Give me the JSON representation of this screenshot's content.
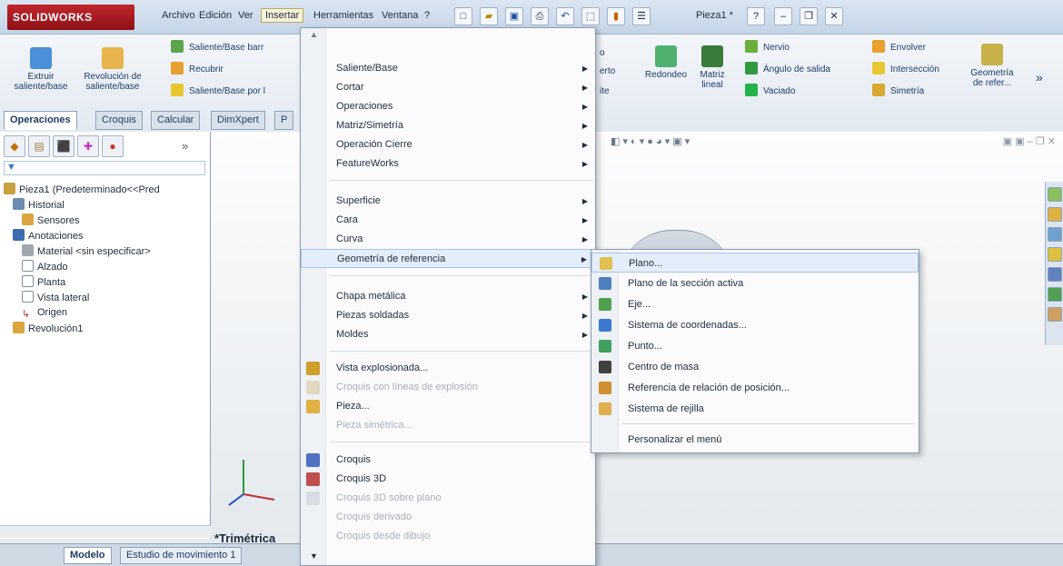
{
  "app": {
    "logo": "SOLIDWORKS",
    "doc_title": "Pieza1 *"
  },
  "menubar": [
    "Archivo",
    "Edición",
    "Ver",
    "Insertar",
    "Herramientas",
    "Ventana",
    "?"
  ],
  "ribbon": {
    "extrude": "Extruir saliente/base",
    "revolve": "Revolución de saliente/base",
    "list1": [
      "Saliente/Base barr",
      "Recubrir",
      "Saliente/Base por l"
    ],
    "partial": [
      "o",
      "erto",
      "ite"
    ],
    "fillet": "Redondeo",
    "linear_pattern": "Matriz lineal",
    "list2": [
      "Nervio",
      "Ángulo de salida",
      "Vaciado"
    ],
    "list3": [
      "Envolver",
      "Intersección",
      "Simetría"
    ],
    "ref_geom": "Geometría de refer...",
    "more": "»"
  },
  "tabs": [
    "Operaciones",
    "Croquis",
    "Calcular",
    "DimXpert",
    "P"
  ],
  "tree": {
    "root": "Pieza1  (Predeterminado<<Pred",
    "items": [
      "Historial",
      "Sensores",
      "Anotaciones",
      "Material <sin especificar>",
      "Alzado",
      "Planta",
      "Vista lateral",
      "Origen",
      "Revolución1"
    ]
  },
  "viewport": {
    "view_label": "*Trimétrica"
  },
  "bottom_tabs": [
    "Modelo",
    "Estudio de movimiento 1"
  ],
  "insert_menu": {
    "group1": [
      "Saliente/Base",
      "Cortar",
      "Operaciones",
      "Matriz/Simetría",
      "Operación Cierre",
      "FeatureWorks"
    ],
    "group2": [
      "Superficie",
      "Cara",
      "Curva",
      "Geometría de referencia"
    ],
    "group3": [
      "Chapa metálica",
      "Piezas soldadas",
      "Moldes"
    ],
    "group4": [
      "Vista explosionada...",
      "Croquis con líneas de explosión",
      "Pieza...",
      "Pieza simétrica..."
    ],
    "group5": [
      "Croquis",
      "Croquis 3D",
      "Croquis 3D sobre plano",
      "Croquis derivado",
      "Croquis desde dibujo"
    ]
  },
  "ref_geom_menu": {
    "items": [
      "Plano...",
      "Plano de la sección activa",
      "Eje...",
      "Sistema de coordenadas...",
      "Punto...",
      "Centro de masa",
      "Referencia de relación de posición...",
      "Sistema de rejilla"
    ],
    "customize": "Personalizar el menú"
  }
}
